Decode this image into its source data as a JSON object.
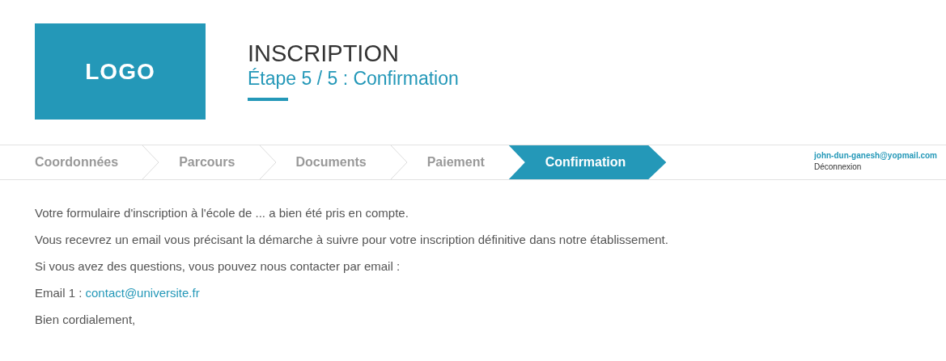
{
  "logo": "LOGO",
  "header": {
    "title": "INSCRIPTION",
    "subtitle": "Étape 5 / 5 : Confirmation"
  },
  "steps": [
    {
      "label": "Coordonnées",
      "selected": false
    },
    {
      "label": "Parcours",
      "selected": false
    },
    {
      "label": "Documents",
      "selected": false
    },
    {
      "label": "Paiement",
      "selected": false
    },
    {
      "label": "Confirmation",
      "selected": true
    }
  ],
  "user": {
    "email": "john-dun-ganesh@yopmail.com",
    "logout": "Déconnexion"
  },
  "message": [
    "Votre formulaire d'inscription à l'école de ... a bien été pris en compte.",
    "Vous recevrez un email vous précisant la démarche à suivre pour votre inscription définitive dans notre établissement.",
    "Si vous avez des questions, vous pouvez nous contacter par email :"
  ],
  "contact": {
    "label": "Email 1 :",
    "link": "contact@universite.fr"
  },
  "closing": "Bien cordialement,"
}
